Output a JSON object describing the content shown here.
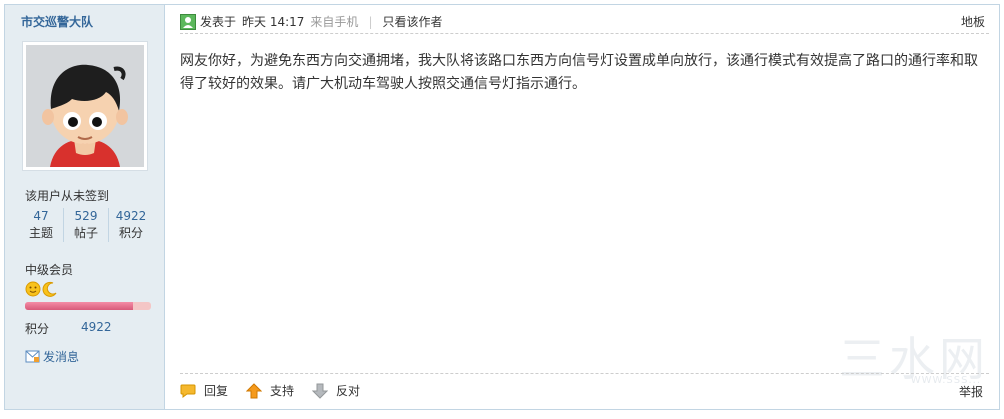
{
  "user": {
    "name": "市交巡警大队",
    "sign_status": "该用户从未签到",
    "stats": [
      {
        "value": "47",
        "label": "主题"
      },
      {
        "value": "529",
        "label": "帖子"
      },
      {
        "value": "4922",
        "label": "积分"
      }
    ],
    "level": "中级会员",
    "level_progress": 0.86,
    "points_label": "积分",
    "points_value": "4922",
    "pm_label": "发消息"
  },
  "post": {
    "posted_label": "发表于",
    "time": "昨天 14:17",
    "source": "来自手机",
    "author_only": "只看该作者",
    "floor": "地板",
    "content": "网友你好，为避免东西方向交通拥堵，我大队将该路口东西方向信号灯设置成单向放行，该通行模式有效提高了路口的通行率和取得了较好的效果。请广大机动车驾驶人按照交通信号灯指示通行。"
  },
  "actions": {
    "reply": "回复",
    "support": "支持",
    "oppose": "反对",
    "report": "举报"
  },
  "watermark": {
    "text": "三水网",
    "sub": "WWW.SSS..."
  },
  "colors": {
    "link": "#336699",
    "sidebar_bg": "#e5edf2",
    "border": "#c2d5e3"
  }
}
